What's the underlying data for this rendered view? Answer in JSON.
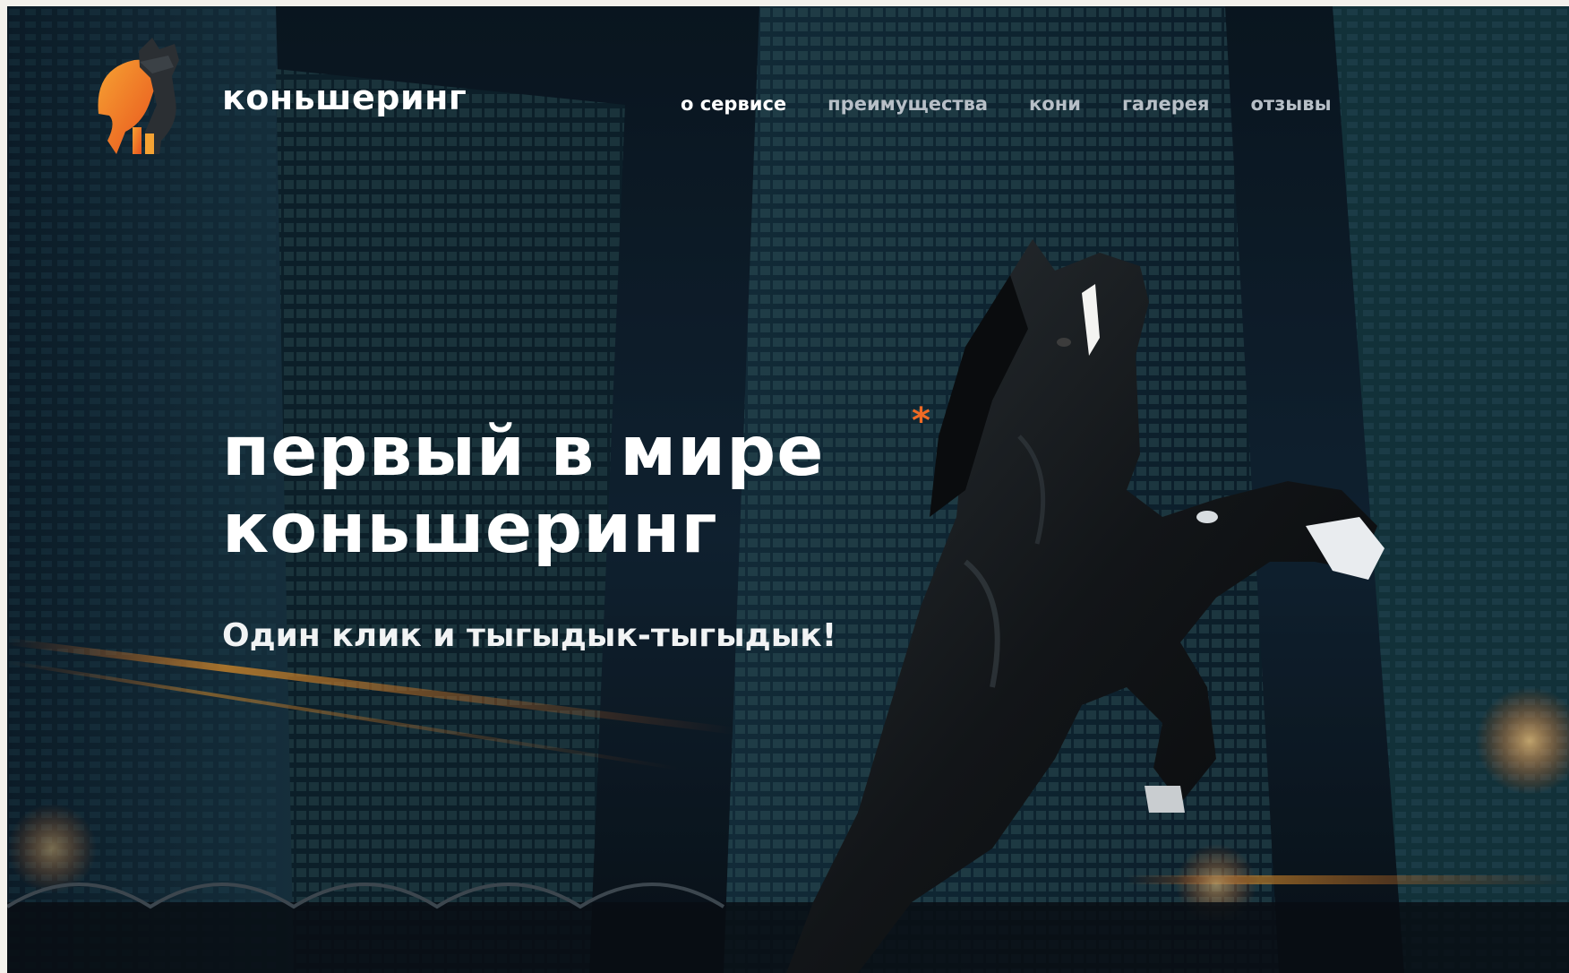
{
  "header": {
    "brand": "коньшеринг",
    "nav": [
      {
        "label": "о сервисе",
        "active": true
      },
      {
        "label": "преимущества",
        "active": false
      },
      {
        "label": "кони",
        "active": false
      },
      {
        "label": "галерея",
        "active": false
      },
      {
        "label": "отзывы",
        "active": false
      }
    ],
    "logo_icon": "horse-logo-icon"
  },
  "hero": {
    "title_line1": "первый в мире",
    "title_line2": "коньшеринг",
    "asterisk": "*",
    "subtitle": "Один клик и тыгыдык-тыгыдык!"
  },
  "colors": {
    "accent": "#f06a24",
    "accent_light": "#f6a233",
    "background": "#0d1822",
    "text": "#ffffff",
    "nav_inactive": "#b7bfc7"
  }
}
